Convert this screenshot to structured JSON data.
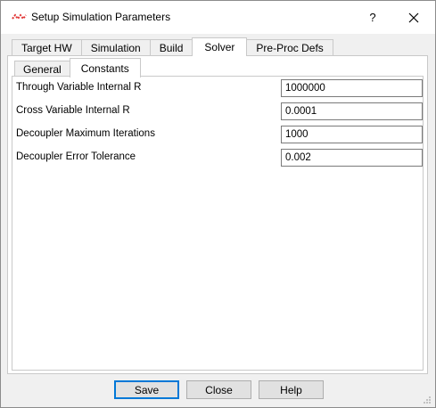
{
  "window": {
    "title": "Setup Simulation Parameters",
    "help_label": "?",
    "close_label": "✕"
  },
  "tabs": [
    {
      "label": "Target HW"
    },
    {
      "label": "Simulation"
    },
    {
      "label": "Build"
    },
    {
      "label": "Solver"
    },
    {
      "label": "Pre-Proc Defs"
    }
  ],
  "subtabs": [
    {
      "label": "General"
    },
    {
      "label": "Constants"
    }
  ],
  "fields": [
    {
      "label": "Through Variable Internal R",
      "value": "1000000"
    },
    {
      "label": "Cross Variable Internal R",
      "value": "0.0001"
    },
    {
      "label": "Decoupler Maximum Iterations",
      "value": "1000"
    },
    {
      "label": "Decoupler Error Tolerance",
      "value": "0.002"
    }
  ],
  "buttons": {
    "save": "Save",
    "close": "Close",
    "help": "Help"
  },
  "colors": {
    "accent": "#0078d7",
    "icon_red": "#e03030"
  }
}
